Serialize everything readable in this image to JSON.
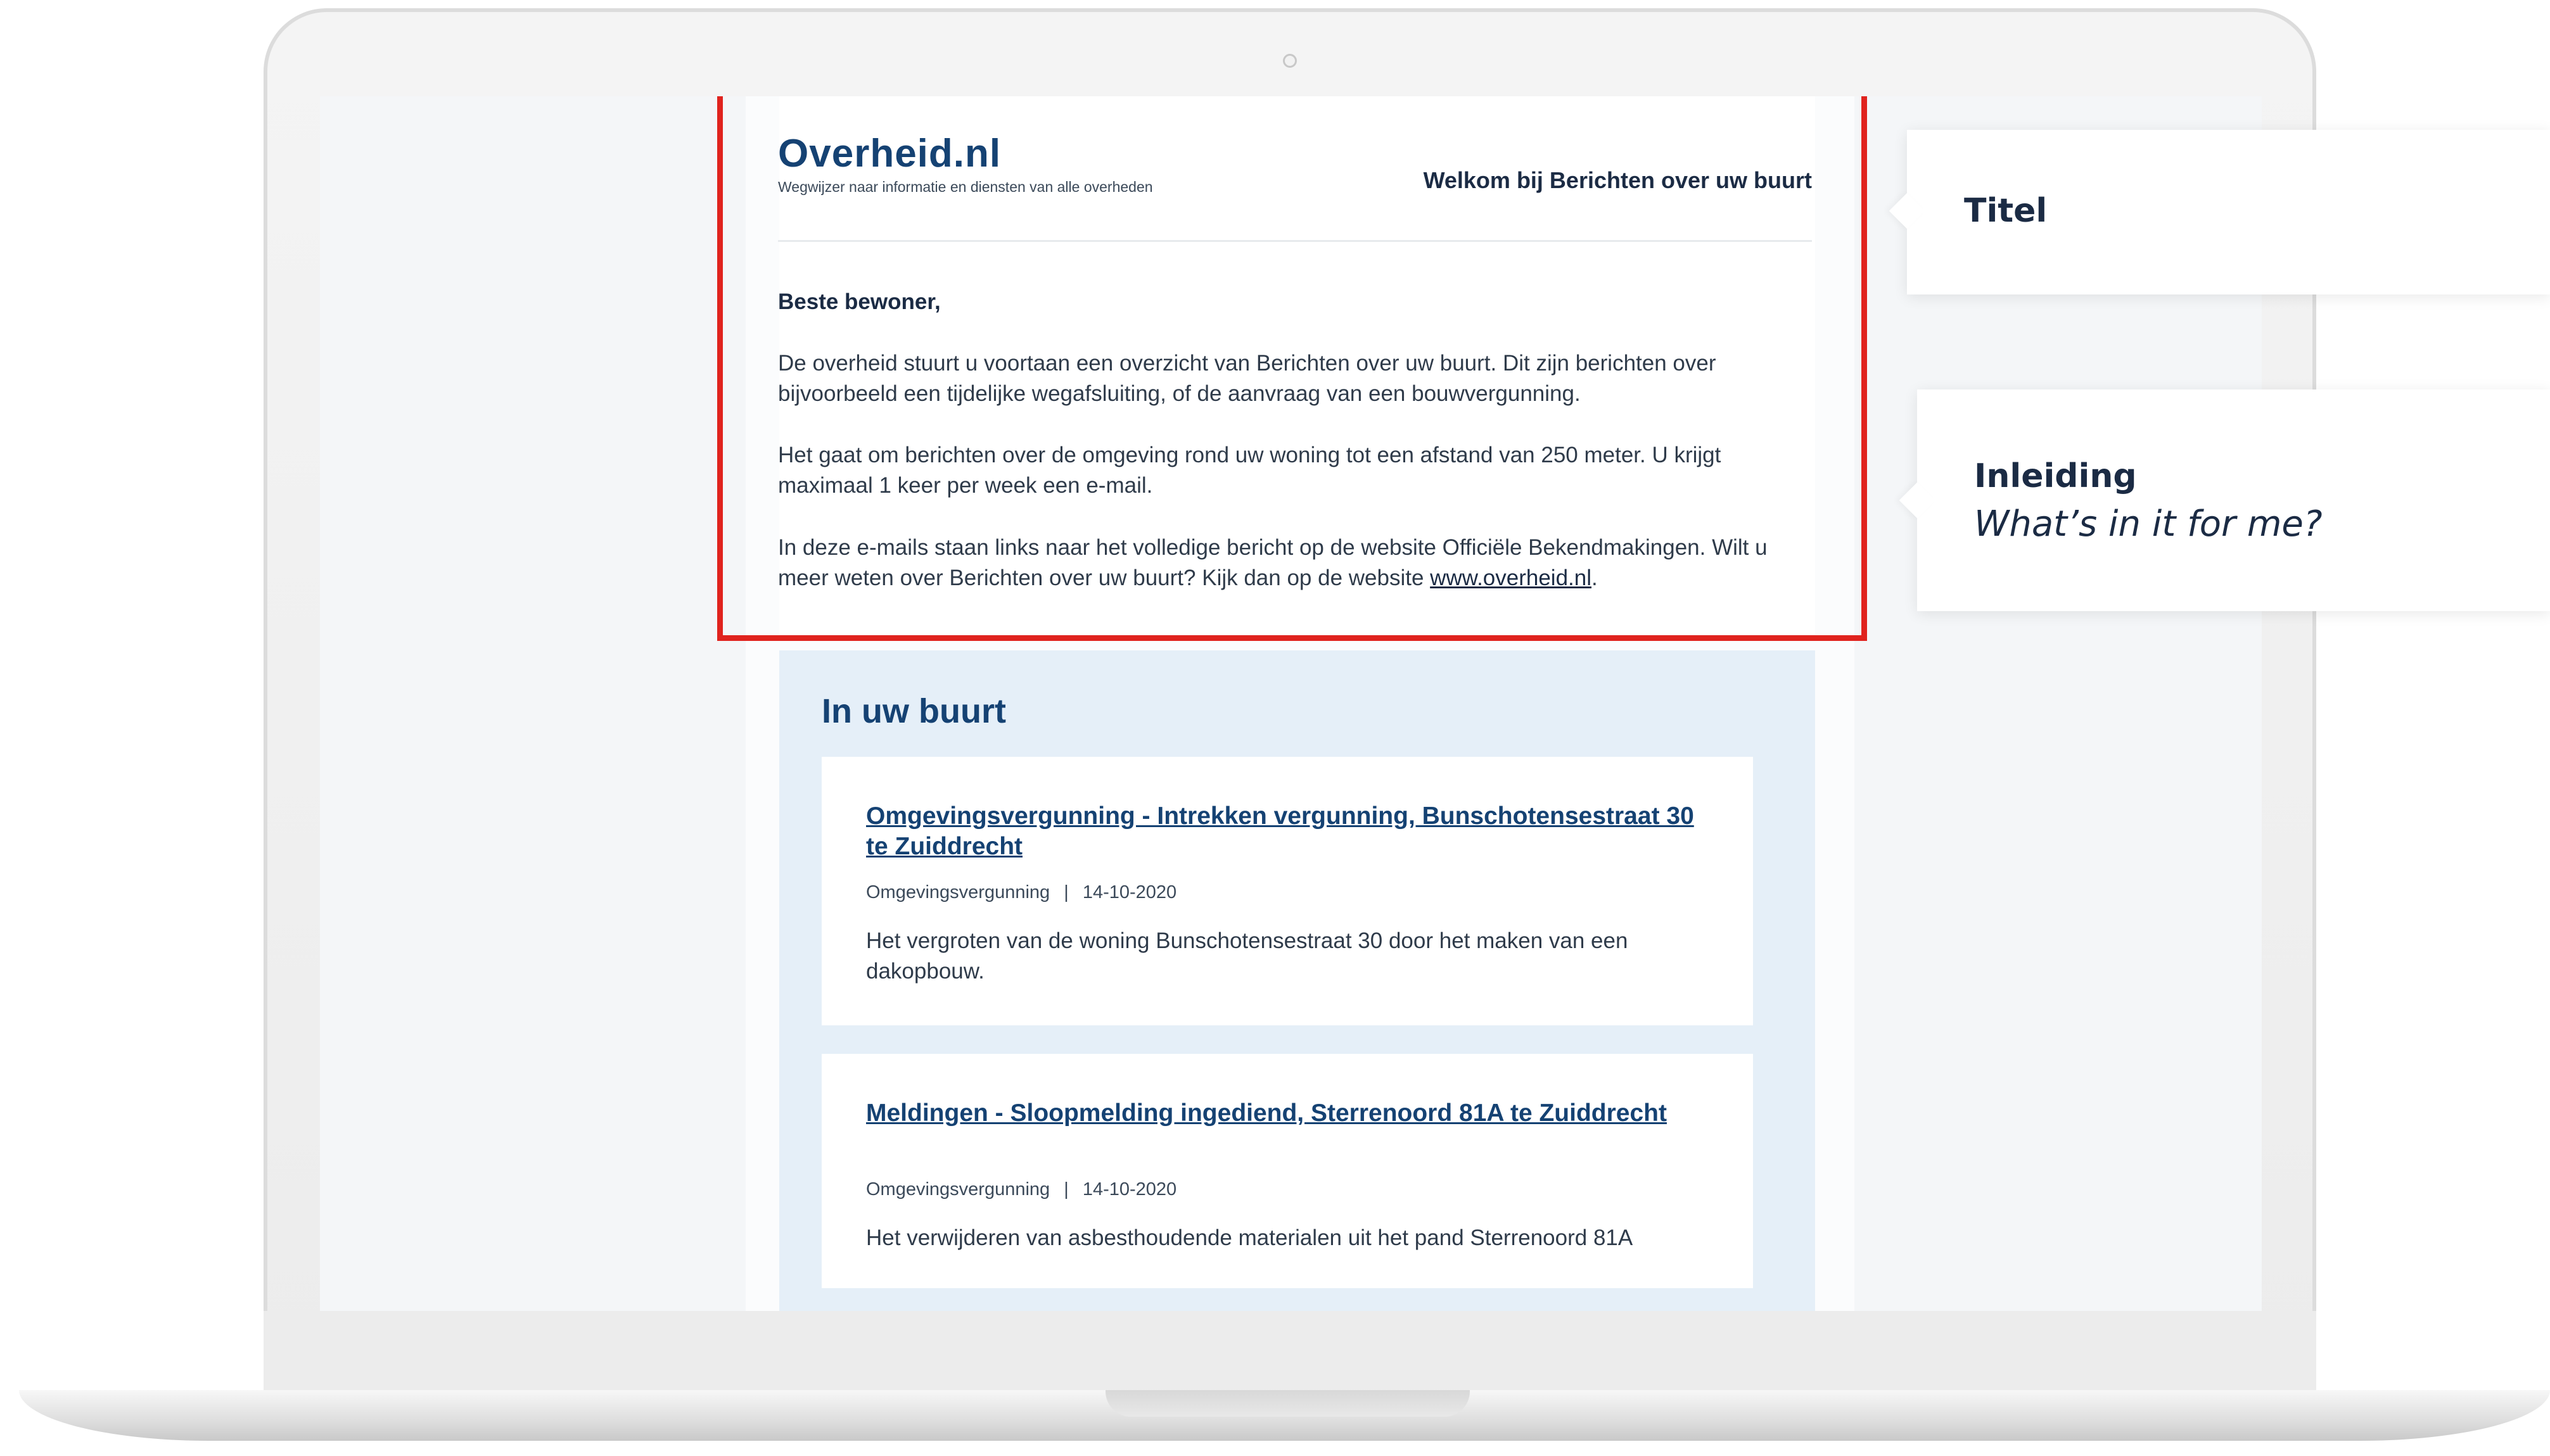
{
  "email": {
    "logo_text": "Overheid.nl",
    "logo_tagline": "Wegwijzer naar informatie en diensten van alle overheden",
    "welcome_title": "Welkom bij Berichten over uw buurt",
    "salutation": "Beste bewoner,",
    "paragraph1": "De overheid stuurt u voortaan een overzicht van Berichten over uw buurt. Dit zijn berichten over bijvoorbeeld een tijdelijke wegafsluiting, of de aanvraag van een bouwvergunning.",
    "paragraph2": "Het gaat om berichten over de omgeving rond uw woning tot een afstand van 250 meter. U krijgt maximaal 1 keer per week een e-mail.",
    "paragraph3_text": "In deze e-mails staan links naar het volledige bericht op de website Officiële Bekendmakingen. Wilt u meer weten over Berichten over uw buurt? Kijk dan op de website ",
    "paragraph3_link": "www.overheid.nl",
    "paragraph3_end": ".",
    "section_title": "In uw buurt",
    "items": [
      {
        "title": "Omgevingsvergunning - Intrekken vergunning, Bunschotensestraat 30 te Zuiddrecht",
        "category": "Omgevingsvergunning",
        "separator": "|",
        "date": "14-10-2020",
        "description": "Het vergroten van de woning Bunschotensestraat 30 door het maken van een dakopbouw."
      },
      {
        "title": "Meldingen - Sloopmelding ingediend, Sterrenoord 81A te Zuiddrecht",
        "category": "Omgevingsvergunning",
        "separator": "|",
        "date": "14-10-2020",
        "description": "Het verwijderen van asbesthoudende materialen uit het pand Sterrenoord 81A"
      }
    ]
  },
  "callouts": {
    "titel": "Titel",
    "inleiding_title": "Inleiding",
    "inleiding_sub": "What’s in it for me?"
  },
  "colors": {
    "highlight": "#e0231e",
    "brand_blue": "#154273",
    "panel": "#e5eff8"
  },
  "icons": {
    "camera": "camera-icon"
  }
}
